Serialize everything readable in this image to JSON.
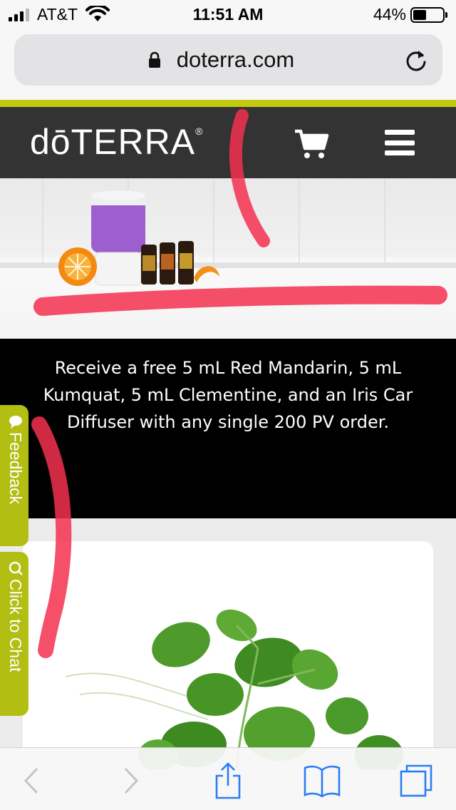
{
  "status_bar": {
    "carrier": "AT&T",
    "time": "11:51 AM",
    "battery_percent": "44%",
    "battery_level": 0.44,
    "signal_bars": 3,
    "signal_bars_total": 4
  },
  "browser": {
    "url": "doterra.com"
  },
  "site": {
    "logo": "dōTERRA",
    "logo_mark": "®",
    "accent_color": "#c3c911",
    "header_color": "#333333"
  },
  "promo": {
    "text": "Receive a free 5 mL Red Mandarin, 5 mL Kumquat, 5 mL Clementine, and an Iris Car Diffuser with any single 200 PV order."
  },
  "side_tabs": {
    "feedback": "Feedback",
    "chat": "Click to Chat",
    "color": "#b3be13"
  },
  "icons": {
    "cart": "cart-icon",
    "menu": "hamburger-menu-icon",
    "lock": "lock-icon",
    "reload": "reload-icon",
    "back": "back-arrow-icon",
    "forward": "forward-arrow-icon",
    "share": "share-icon",
    "bookmarks": "bookmarks-icon",
    "tabs": "tabs-icon"
  },
  "toolbar_color": "#2a7ef5"
}
